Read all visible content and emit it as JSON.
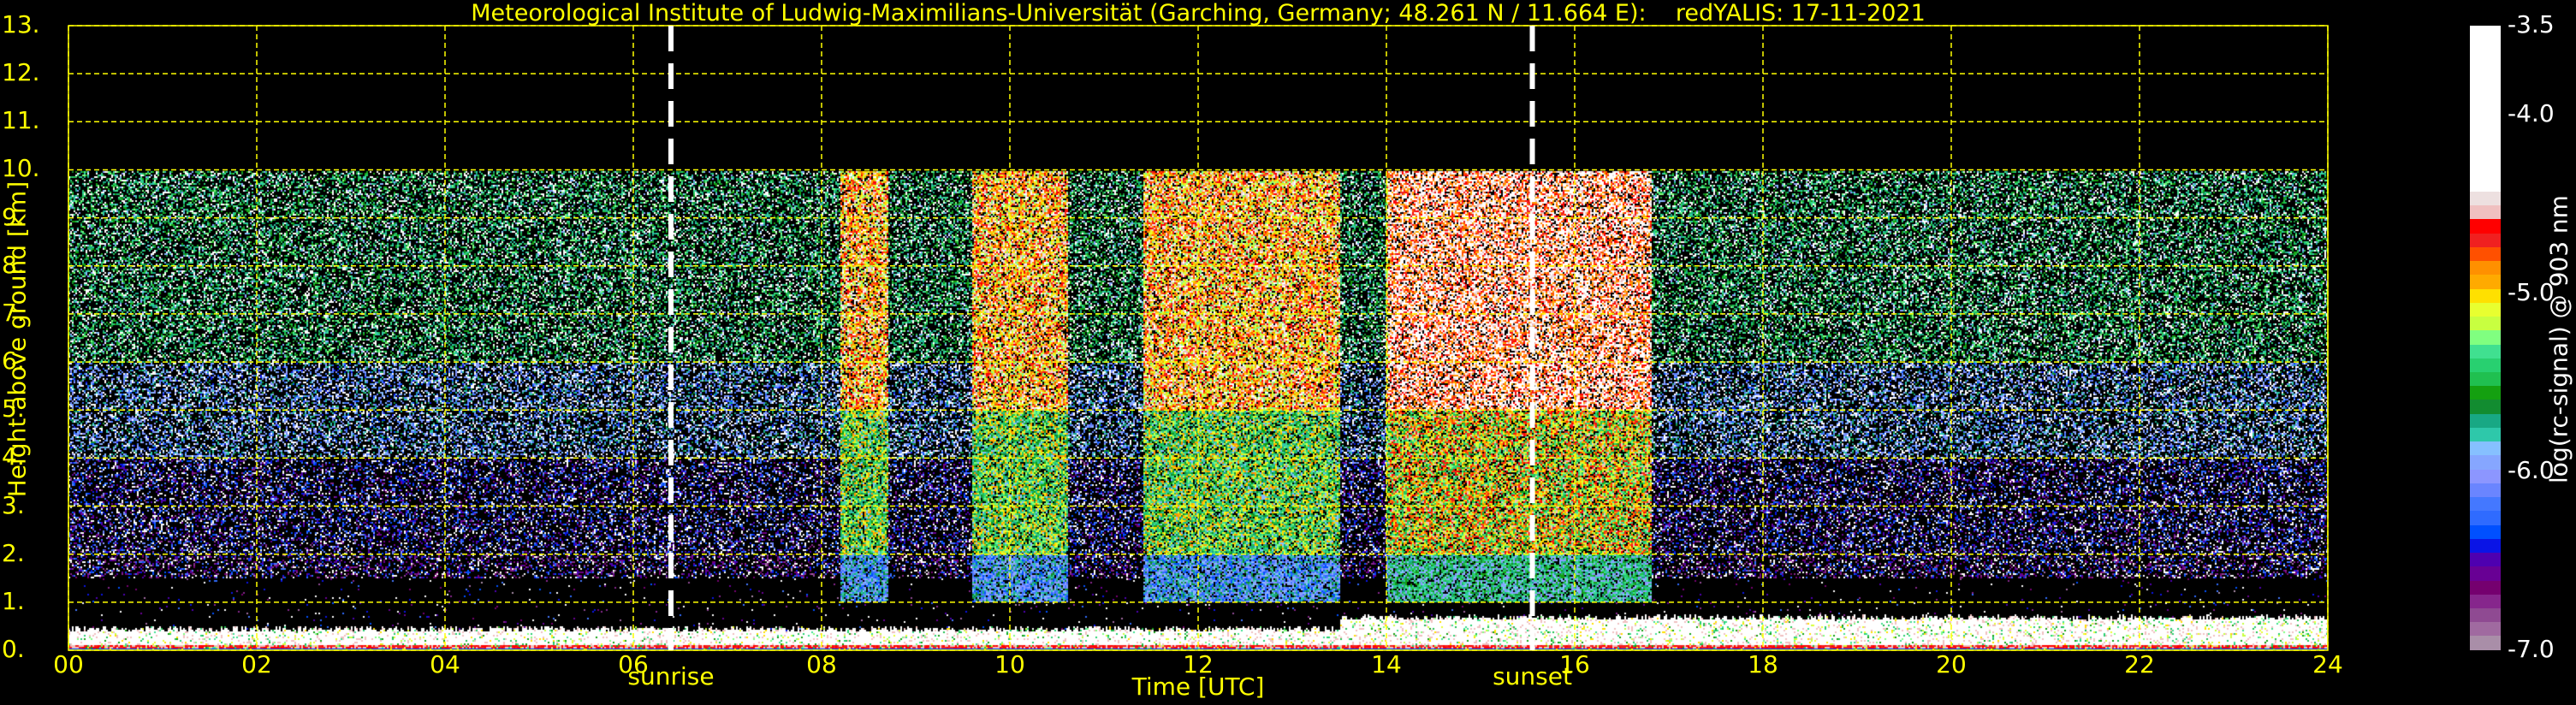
{
  "chart_data": {
    "type": "heatmap",
    "title": "Meteorological Institute of Ludwig-Maximilians-Universität (Garching, Germany; 48.261 N / 11.664 E):    redYALIS: 17-11-2021",
    "xlabel": "Time [UTC]",
    "ylabel": "Height above ground [km]",
    "xlim": [
      0,
      24
    ],
    "ylim": [
      0,
      13
    ],
    "data_top_km": 10,
    "x_ticks": [
      0,
      2,
      4,
      6,
      8,
      10,
      12,
      14,
      16,
      18,
      20,
      22,
      24
    ],
    "x_tick_labels": [
      "00",
      "02",
      "04",
      "06",
      "08",
      "10",
      "12",
      "14",
      "16",
      "18",
      "20",
      "22",
      "24"
    ],
    "y_ticks": [
      0,
      1,
      2,
      3,
      4,
      5,
      6,
      7,
      8,
      9,
      10,
      11,
      12,
      13
    ],
    "y_tick_labels": [
      "0.",
      "1.",
      "2.",
      "3.",
      "4.",
      "5.",
      "6.",
      "7.",
      "8.",
      "9.",
      "10.",
      "11.",
      "12.",
      "13."
    ],
    "grid": true,
    "annotations": [
      {
        "label": "sunrise",
        "time_h": 6.4
      },
      {
        "label": "sunset",
        "time_h": 15.55
      }
    ],
    "features": [
      {
        "type": "boundary_layer",
        "from_h": 0,
        "to_h": 24,
        "top_km": 0.4
      },
      {
        "type": "cloud",
        "from_h": 8.2,
        "to_h": 8.7,
        "base_km": 1.0,
        "top_km": 10
      },
      {
        "type": "cloud",
        "from_h": 9.6,
        "to_h": 10.6,
        "base_km": 1.0,
        "top_km": 10
      },
      {
        "type": "cloud",
        "from_h": 11.4,
        "to_h": 13.5,
        "base_km": 1.0,
        "top_km": 10
      },
      {
        "type": "cloud",
        "from_h": 14.0,
        "to_h": 16.8,
        "base_km": 1.0,
        "top_km": 10
      }
    ],
    "colorbar": {
      "label": "log(rc-signal) @ 903 nm",
      "range": [
        -7.0,
        -3.5
      ],
      "ticks": [
        -3.5,
        -4.0,
        -5.0,
        -6.0,
        -7.0
      ],
      "tick_labels": [
        "-3.5",
        "-4.0",
        "-5.0",
        "-6.0",
        "-7.0"
      ],
      "colors_bottom_to_top": [
        "#a98ea8",
        "#a06aa0",
        "#8f4a92",
        "#86268c",
        "#75006f",
        "#680094",
        "#4e00b0",
        "#0a14e6",
        "#0050ff",
        "#2f6bff",
        "#4478ff",
        "#6a85ff",
        "#8c96ff",
        "#86a6ff",
        "#86c0ff",
        "#2ec8aa",
        "#18a884",
        "#128c30",
        "#14a010",
        "#20c050",
        "#28d070",
        "#40e090",
        "#80ff80",
        "#c8ff40",
        "#e8ff30",
        "#ffe000",
        "#ffaa00",
        "#ff9000",
        "#ff5000",
        "#f02020",
        "#ff0000",
        "#f0c0c0",
        "#ede0e0",
        "#ffffff"
      ]
    }
  }
}
